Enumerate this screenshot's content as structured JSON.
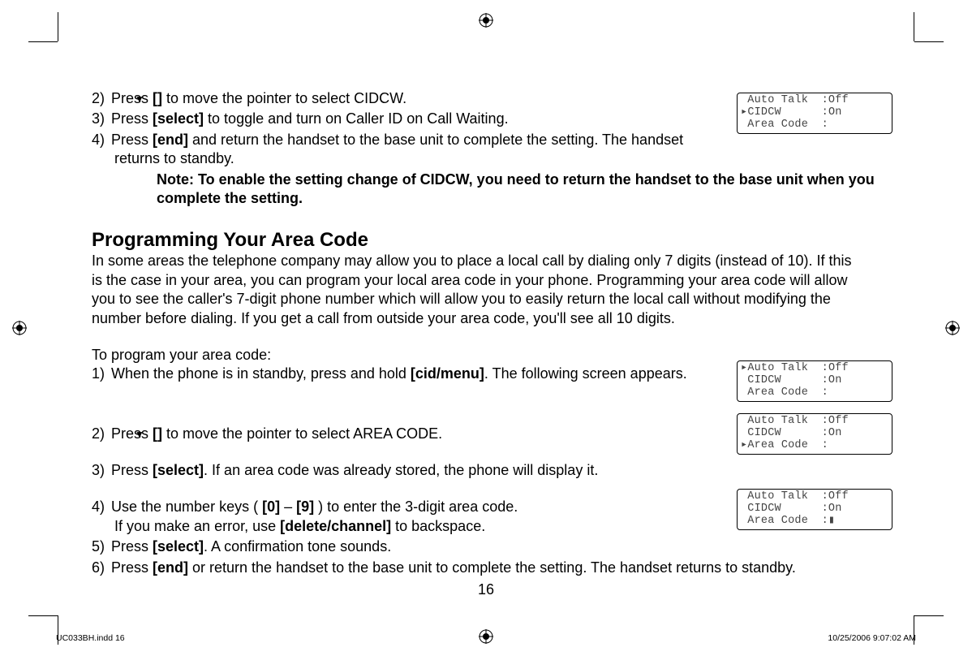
{
  "top_steps": [
    {
      "num": "2)",
      "html": "Press <b>[<span class=\"arrow-down\">▼</span>]</b> to move the pointer to select CIDCW."
    },
    {
      "num": "3)",
      "html": "Press <b>[select]</b> to toggle and turn on Caller ID on Call Waiting."
    },
    {
      "num": "4)",
      "html": "Press <b>[end]</b> and return the handset to the base unit to complete the setting. The handset returns to standby."
    }
  ],
  "note": "Note: To enable the setting change of CIDCW, you need to return the handset to the base unit when you complete the setting.",
  "section_title": "Programming Your Area Code",
  "section_para": "In some areas the telephone company may allow you to place a local call by dialing only 7 digits (instead of 10). If this is the case in your area, you can program your local area code in your phone. Programming your area code will allow you to see the caller's 7-digit phone number which will allow you to easily return the local call without modifying the number before dialing. If you get a call from outside your area code, you'll see all 10 digits.",
  "lead_in": "To program your area code:",
  "steps2": [
    {
      "num": "1)",
      "html": "When the phone is in standby, press and hold <b>[cid/menu]</b>. The following screen appears."
    },
    {
      "num": "2)",
      "html": "Press <b>[<span class=\"arrow-down\">▼</span>]</b> to move the pointer to select AREA CODE."
    },
    {
      "num": "3)",
      "html": "Press <b>[select]</b>. If an area code was already stored, the phone will display it."
    },
    {
      "num": "4)",
      "html": "Use the number keys ( <b>[0]</b> – <b>[9]</b> ) to enter the 3-digit area code.<br>If you make an error, use <b>[delete/channel]</b> to backspace."
    },
    {
      "num": "5)",
      "html": "Press <b>[select]</b>. A confirmation tone sounds."
    },
    {
      "num": "6)",
      "html": "Press <b>[end]</b> or return the handset to the base unit to complete the setting. The handset returns to standby."
    }
  ],
  "lcd1": " Auto Talk  :Off\n▸CIDCW      :On\n Area Code  :",
  "lcd2": "▸Auto Talk  :Off\n CIDCW      :On\n Area Code  :",
  "lcd3": " Auto Talk  :Off\n CIDCW      :On\n▸Area Code  :",
  "lcd4": " Auto Talk  :Off\n CIDCW      :On\n Area Code  :▮",
  "pagenum": "16",
  "footer_left": "UC033BH.indd   16",
  "footer_right": "10/25/2006   9:07:02 AM"
}
